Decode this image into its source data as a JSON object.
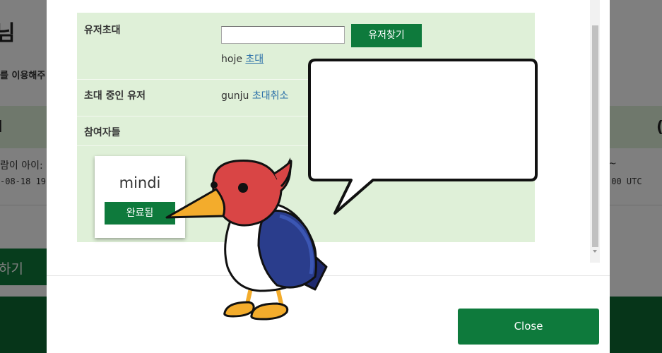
{
  "background_page": {
    "title_fragment": "님",
    "desc_fragment": "를 이용해주",
    "band_left_fragment": "l",
    "band_right_fragment": "(",
    "row_text_fragment": "람이 아이:",
    "row_date_fragment": "-08-18 19:",
    "row_text_right_fragment": "~",
    "row_date_right_fragment": ":00 UTC",
    "button_fragment": "하기"
  },
  "modal": {
    "invite": {
      "label": "유저초대",
      "input_value": "",
      "search_button": "유저찾기",
      "result_user": "hoje",
      "result_action": "초대"
    },
    "pending": {
      "label": "초대 중인 유저",
      "user": "gunju",
      "action": "초대취소"
    },
    "participants": {
      "label": "참여자들",
      "items": [
        {
          "name": "mindi",
          "status": "완료됨"
        }
      ]
    },
    "close_button": "Close"
  },
  "mascot": {
    "character": "woodpecker",
    "speech_bubble_text": ""
  },
  "colors": {
    "primary_green": "#0e7a3c",
    "panel_green": "#dff0d8",
    "link_blue": "#2a6fa8",
    "bird_red": "#d94545",
    "bird_navy": "#1f2a6e",
    "beak_orange": "#f3ac2c"
  }
}
